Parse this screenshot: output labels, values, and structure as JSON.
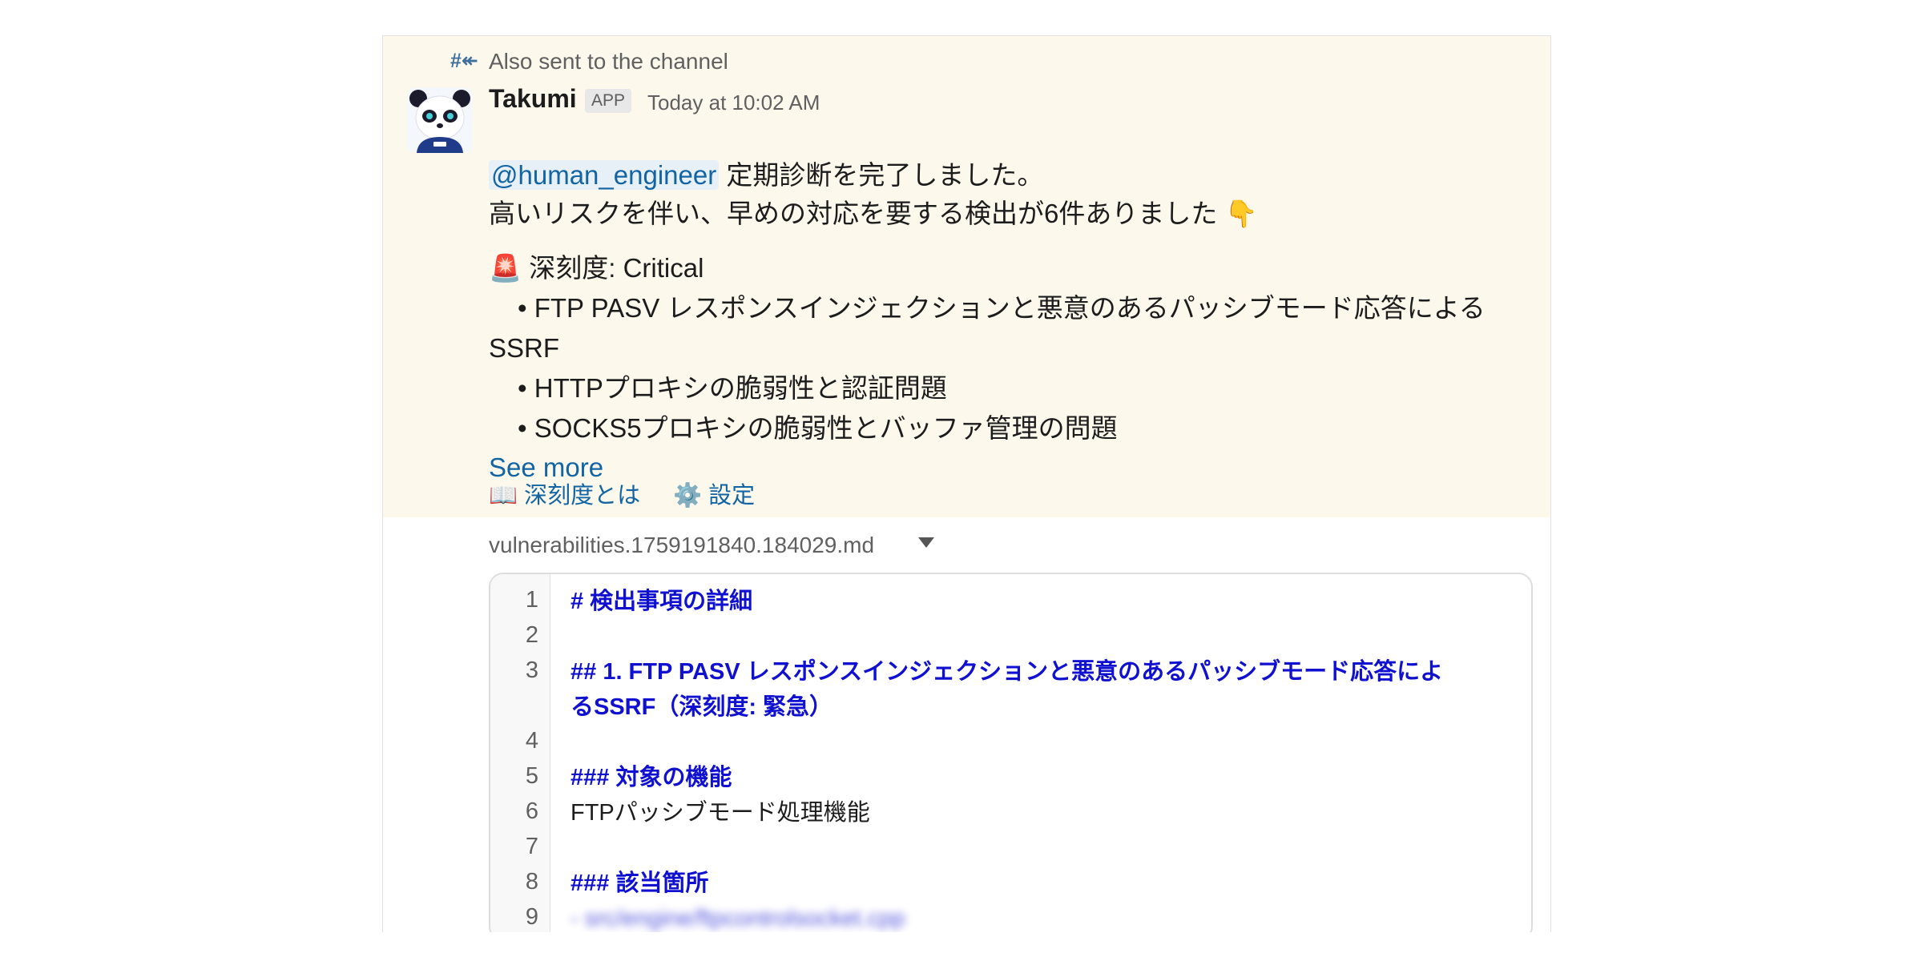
{
  "message": {
    "also_sent": "Also sent to the channel",
    "sender": "Takumi",
    "badge": "APP",
    "timestamp": "Today at 10:02 AM",
    "mention": "@human_engineer",
    "line1_rest": " 定期診断を完了しました。",
    "line2": "高いリスクを伴い、早めの対応を要する検出が6件ありました",
    "pointing_emoji": "👇",
    "severity_emoji": "🚨",
    "severity_label": "深刻度: Critical",
    "bullets": [
      "FTP PASV レスポンスインジェクションと悪意のあるパッシブモード応答による",
      "HTTPプロキシの脆弱性と認証問題",
      "SOCKS5プロキシの脆弱性とバッファ管理の問題"
    ],
    "bullet1_wrap": "SSRF",
    "see_more": "See more",
    "actions": [
      {
        "emoji": "📖",
        "label": "深刻度とは"
      },
      {
        "emoji": "⚙️",
        "label": "設定"
      }
    ]
  },
  "file": {
    "name": "vulnerabilities.1759191840.184029.md",
    "lines": [
      {
        "n": "1",
        "text": "# 検出事項の詳細",
        "style": "heading"
      },
      {
        "n": "2",
        "text": "",
        "style": "plain"
      },
      {
        "n": "3",
        "text": "## 1. FTP PASV レスポンスインジェクションと悪意のあるパッシブモード応答によ",
        "style": "heading"
      },
      {
        "n": "",
        "text": "るSSRF（深刻度: 緊急）",
        "style": "heading"
      },
      {
        "n": "4",
        "text": "",
        "style": "plain"
      },
      {
        "n": "5",
        "text": "### 対象の機能",
        "style": "heading"
      },
      {
        "n": "6",
        "text": "FTPパッシブモード処理機能",
        "style": "plain"
      },
      {
        "n": "7",
        "text": "",
        "style": "plain"
      },
      {
        "n": "8",
        "text": "### 該当箇所",
        "style": "heading"
      },
      {
        "n": "9",
        "text": "- src/engine/ftpcontrolsocket.cpp",
        "style": "blurred"
      }
    ]
  },
  "icons": {
    "also_sent": "reply-to-channel-icon",
    "avatar": "panda-avatar",
    "caret": "chevron-down-icon"
  },
  "colors": {
    "highlight_bg": "#fcf8ec",
    "link": "#1264a3",
    "code_heading": "#1010d0"
  }
}
